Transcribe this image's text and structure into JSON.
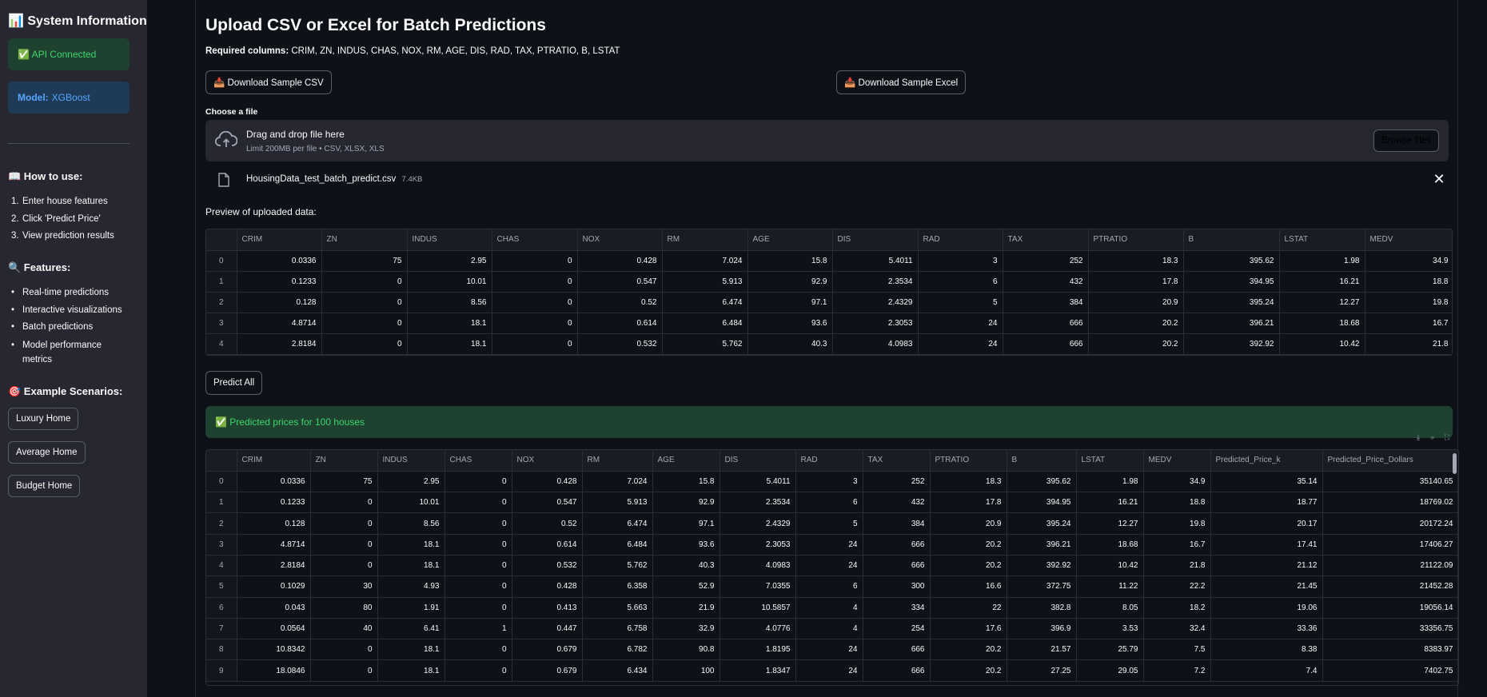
{
  "sidebar": {
    "title": "📊 System Information",
    "api_status": "✅ API Connected",
    "model_label": "Model:",
    "model_value": "XGBoost",
    "how_to_title": "📖 How to use:",
    "how_to_items": [
      "Enter house features",
      "Click 'Predict Price'",
      "View prediction results"
    ],
    "features_title": "🔍 Features:",
    "features_items": [
      "Real-time predictions",
      "Interactive visualizations",
      "Batch predictions",
      "Model performance metrics"
    ],
    "scenarios_title": "🎯 Example Scenarios:",
    "scenario_buttons": [
      "Luxury Home",
      "Average Home",
      "Budget Home"
    ]
  },
  "main": {
    "title": "Upload CSV or Excel for Batch Predictions",
    "required_label": "Required columns:",
    "required_value": "CRIM, ZN, INDUS, CHAS, NOX, RM, AGE, DIS, RAD, TAX, PTRATIO, B, LSTAT",
    "download_csv": "📥 Download Sample CSV",
    "download_excel": "📥 Download Sample Excel",
    "choose_file_label": "Choose a file",
    "dropzone_title": "Drag and drop file here",
    "dropzone_limit": "Limit 200MB per file • CSV, XLSX, XLS",
    "browse_button": "Browse files",
    "file_name": "HousingData_test_batch_predict.csv",
    "file_size": "7.4KB",
    "file_remove": "✕",
    "preview_label": "Preview of uploaded data:",
    "predict_all": "Predict All",
    "success_text": "✅ Predicted prices for 100 houses"
  },
  "preview_table": {
    "columns": [
      "",
      "CRIM",
      "ZN",
      "INDUS",
      "CHAS",
      "NOX",
      "RM",
      "AGE",
      "DIS",
      "RAD",
      "TAX",
      "PTRATIO",
      "B",
      "LSTAT",
      "MEDV"
    ],
    "rows": [
      [
        "0",
        "0.0336",
        "75",
        "2.95",
        "0",
        "0.428",
        "7.024",
        "15.8",
        "5.4011",
        "3",
        "252",
        "18.3",
        "395.62",
        "1.98",
        "34.9"
      ],
      [
        "1",
        "0.1233",
        "0",
        "10.01",
        "0",
        "0.547",
        "5.913",
        "92.9",
        "2.3534",
        "6",
        "432",
        "17.8",
        "394.95",
        "16.21",
        "18.8"
      ],
      [
        "2",
        "0.128",
        "0",
        "8.56",
        "0",
        "0.52",
        "6.474",
        "97.1",
        "2.4329",
        "5",
        "384",
        "20.9",
        "395.24",
        "12.27",
        "19.8"
      ],
      [
        "3",
        "4.8714",
        "0",
        "18.1",
        "0",
        "0.614",
        "6.484",
        "93.6",
        "2.3053",
        "24",
        "666",
        "20.2",
        "396.21",
        "18.68",
        "16.7"
      ],
      [
        "4",
        "2.8184",
        "0",
        "18.1",
        "0",
        "0.532",
        "5.762",
        "40.3",
        "4.0983",
        "24",
        "666",
        "20.2",
        "392.92",
        "10.42",
        "21.8"
      ]
    ]
  },
  "result_table": {
    "columns": [
      "",
      "CRIM",
      "ZN",
      "INDUS",
      "CHAS",
      "NOX",
      "RM",
      "AGE",
      "DIS",
      "RAD",
      "TAX",
      "PTRATIO",
      "B",
      "LSTAT",
      "MEDV",
      "Predicted_Price_k",
      "Predicted_Price_Dollars"
    ],
    "rows": [
      [
        "0",
        "0.0336",
        "75",
        "2.95",
        "0",
        "0.428",
        "7.024",
        "15.8",
        "5.4011",
        "3",
        "252",
        "18.3",
        "395.62",
        "1.98",
        "34.9",
        "35.14",
        "35140.65"
      ],
      [
        "1",
        "0.1233",
        "0",
        "10.01",
        "0",
        "0.547",
        "5.913",
        "92.9",
        "2.3534",
        "6",
        "432",
        "17.8",
        "394.95",
        "16.21",
        "18.8",
        "18.77",
        "18769.02"
      ],
      [
        "2",
        "0.128",
        "0",
        "8.56",
        "0",
        "0.52",
        "6.474",
        "97.1",
        "2.4329",
        "5",
        "384",
        "20.9",
        "395.24",
        "12.27",
        "19.8",
        "20.17",
        "20172.24"
      ],
      [
        "3",
        "4.8714",
        "0",
        "18.1",
        "0",
        "0.614",
        "6.484",
        "93.6",
        "2.3053",
        "24",
        "666",
        "20.2",
        "396.21",
        "18.68",
        "16.7",
        "17.41",
        "17406.27"
      ],
      [
        "4",
        "2.8184",
        "0",
        "18.1",
        "0",
        "0.532",
        "5.762",
        "40.3",
        "4.0983",
        "24",
        "666",
        "20.2",
        "392.92",
        "10.42",
        "21.8",
        "21.12",
        "21122.09"
      ],
      [
        "5",
        "0.1029",
        "30",
        "4.93",
        "0",
        "0.428",
        "6.358",
        "52.9",
        "7.0355",
        "6",
        "300",
        "16.6",
        "372.75",
        "11.22",
        "22.2",
        "21.45",
        "21452.28"
      ],
      [
        "6",
        "0.043",
        "80",
        "1.91",
        "0",
        "0.413",
        "5.663",
        "21.9",
        "10.5857",
        "4",
        "334",
        "22",
        "382.8",
        "8.05",
        "18.2",
        "19.06",
        "19056.14"
      ],
      [
        "7",
        "0.0564",
        "40",
        "6.41",
        "1",
        "0.447",
        "6.758",
        "32.9",
        "4.0776",
        "4",
        "254",
        "17.6",
        "396.9",
        "3.53",
        "32.4",
        "33.36",
        "33356.75"
      ],
      [
        "8",
        "10.8342",
        "0",
        "18.1",
        "0",
        "0.679",
        "6.782",
        "90.8",
        "1.8195",
        "24",
        "666",
        "20.2",
        "21.57",
        "25.79",
        "7.5",
        "8.38",
        "8383.97"
      ],
      [
        "9",
        "18.0846",
        "0",
        "18.1",
        "0",
        "0.679",
        "6.434",
        "100",
        "1.8347",
        "24",
        "666",
        "20.2",
        "27.25",
        "29.05",
        "7.2",
        "7.4",
        "7402.75"
      ]
    ]
  }
}
